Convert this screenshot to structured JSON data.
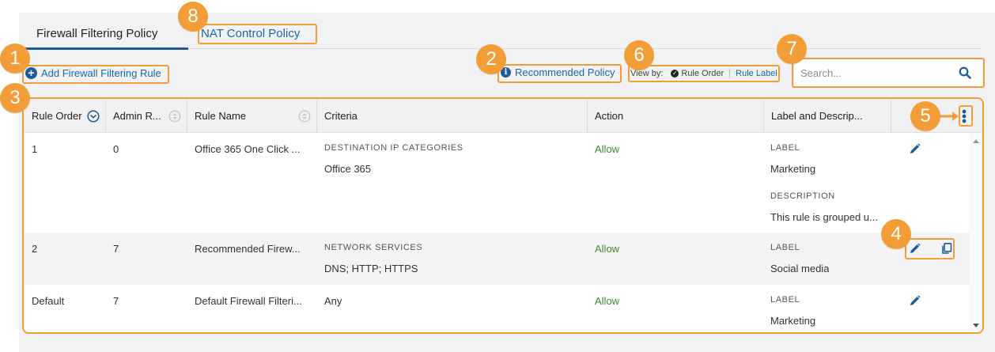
{
  "tabs": {
    "filtering": "Firewall Filtering Policy",
    "nat": "NAT Control Policy"
  },
  "toolbar": {
    "add_rule": "Add Firewall Filtering Rule",
    "recommended_policy": "Recommended Policy",
    "view_by_label": "View by:",
    "view_by_rule_order": "Rule Order",
    "view_by_rule_label": "Rule Label",
    "search_placeholder": "Search..."
  },
  "table": {
    "columns": [
      "Rule Order",
      "Admin R...",
      "Rule Name",
      "Criteria",
      "Action",
      "Label and Descrip..."
    ],
    "rows": [
      {
        "order": "1",
        "admin_rank": "0",
        "name": "Office 365 One Click ...",
        "criteria_caption": "DESTINATION IP CATEGORIES",
        "criteria_value": "Office 365",
        "action": "Allow",
        "label_caption": "LABEL",
        "label_value": "Marketing",
        "desc_caption": "DESCRIPTION",
        "desc_value": "This rule is grouped u..."
      },
      {
        "order": "2",
        "admin_rank": "7",
        "name": "Recommended Firew...",
        "criteria_caption": "NETWORK SERVICES",
        "criteria_value": "DNS; HTTP; HTTPS",
        "action": "Allow",
        "label_caption": "LABEL",
        "label_value": "Social media"
      },
      {
        "order": "Default",
        "admin_rank": "7",
        "name": "Default Firewall Filteri...",
        "criteria_value": "Any",
        "action": "Allow",
        "label_caption": "LABEL",
        "label_value": "Marketing"
      }
    ]
  },
  "callouts": [
    "1",
    "2",
    "3",
    "4",
    "5",
    "6",
    "7",
    "8"
  ],
  "colors": {
    "accent": "#1f5b97",
    "link": "#1b67a8",
    "allow": "#3e8b2c",
    "annotation": "#f29d38"
  },
  "icons": [
    "plus-circle-icon",
    "info-icon",
    "check-circle-icon",
    "search-icon",
    "sort-circle-icon",
    "sort-updown-icon",
    "kebab-menu-icon",
    "pencil-icon",
    "copy-icon"
  ]
}
